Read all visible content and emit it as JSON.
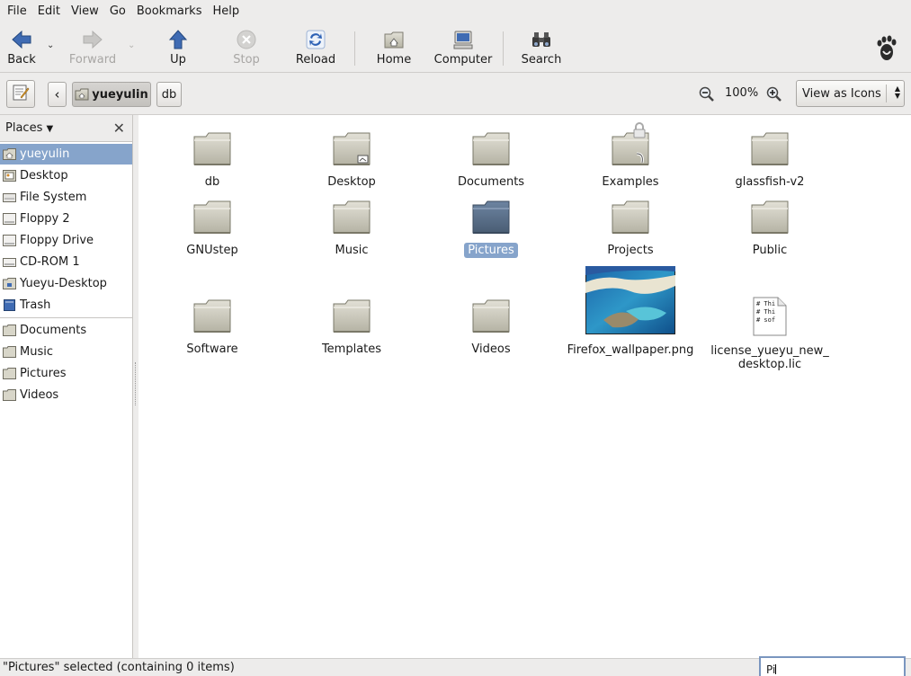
{
  "menu": {
    "file": "File",
    "edit": "Edit",
    "view": "View",
    "go": "Go",
    "bookmarks": "Bookmarks",
    "help": "Help"
  },
  "toolbar": {
    "back": "Back",
    "forward": "Forward",
    "up": "Up",
    "stop": "Stop",
    "reload": "Reload",
    "home": "Home",
    "computer": "Computer",
    "search": "Search"
  },
  "location": {
    "back_glyph": "‹",
    "crumbs": [
      "yueyulin",
      "db"
    ],
    "zoom": "100%",
    "view_mode": "View as Icons"
  },
  "sidebar": {
    "title": "Places",
    "items": [
      {
        "label": "yueyulin",
        "icon": "home-folder-icon"
      },
      {
        "label": "Desktop",
        "icon": "desktop-icon"
      },
      {
        "label": "File System",
        "icon": "drive-icon"
      },
      {
        "label": "Floppy 2",
        "icon": "floppy-icon"
      },
      {
        "label": "Floppy Drive",
        "icon": "floppy-icon"
      },
      {
        "label": "CD-ROM 1",
        "icon": "cdrom-icon"
      },
      {
        "label": "Yueyu-Desktop",
        "icon": "network-folder-icon"
      },
      {
        "label": "Trash",
        "icon": "trash-icon"
      }
    ],
    "bookmarks": [
      {
        "label": "Documents",
        "icon": "folder-icon"
      },
      {
        "label": "Music",
        "icon": "folder-icon"
      },
      {
        "label": "Pictures",
        "icon": "folder-icon"
      },
      {
        "label": "Videos",
        "icon": "folder-icon"
      }
    ]
  },
  "files": [
    {
      "name": "db",
      "type": "folder"
    },
    {
      "name": "Desktop",
      "type": "folder-desktop"
    },
    {
      "name": "Documents",
      "type": "folder"
    },
    {
      "name": "Examples",
      "type": "folder-link-locked"
    },
    {
      "name": "glassfish-v2",
      "type": "folder"
    },
    {
      "name": "GNUstep",
      "type": "folder"
    },
    {
      "name": "Music",
      "type": "folder"
    },
    {
      "name": "Pictures",
      "type": "folder",
      "selected": true
    },
    {
      "name": "Projects",
      "type": "folder"
    },
    {
      "name": "Public",
      "type": "folder"
    },
    {
      "name": "Software",
      "type": "folder"
    },
    {
      "name": "Templates",
      "type": "folder"
    },
    {
      "name": "Videos",
      "type": "folder"
    },
    {
      "name": "Firefox_wallpaper.png",
      "type": "image"
    },
    {
      "name": "license_yueyu_new_desktop.lic",
      "type": "text",
      "preview": [
        "# Thi",
        "# Thi",
        "# sof"
      ]
    }
  ],
  "file_labels": {
    "license_line1": "license_yueyu_new_",
    "license_line2": "desktop.lic"
  },
  "status": {
    "text": "\"Pictures\" selected (containing 0 items)",
    "typeahead": "Pi"
  },
  "colors": {
    "selection": "#86a4cb",
    "folder": "#c9c7b8",
    "folder_selected": "#5b7089"
  }
}
